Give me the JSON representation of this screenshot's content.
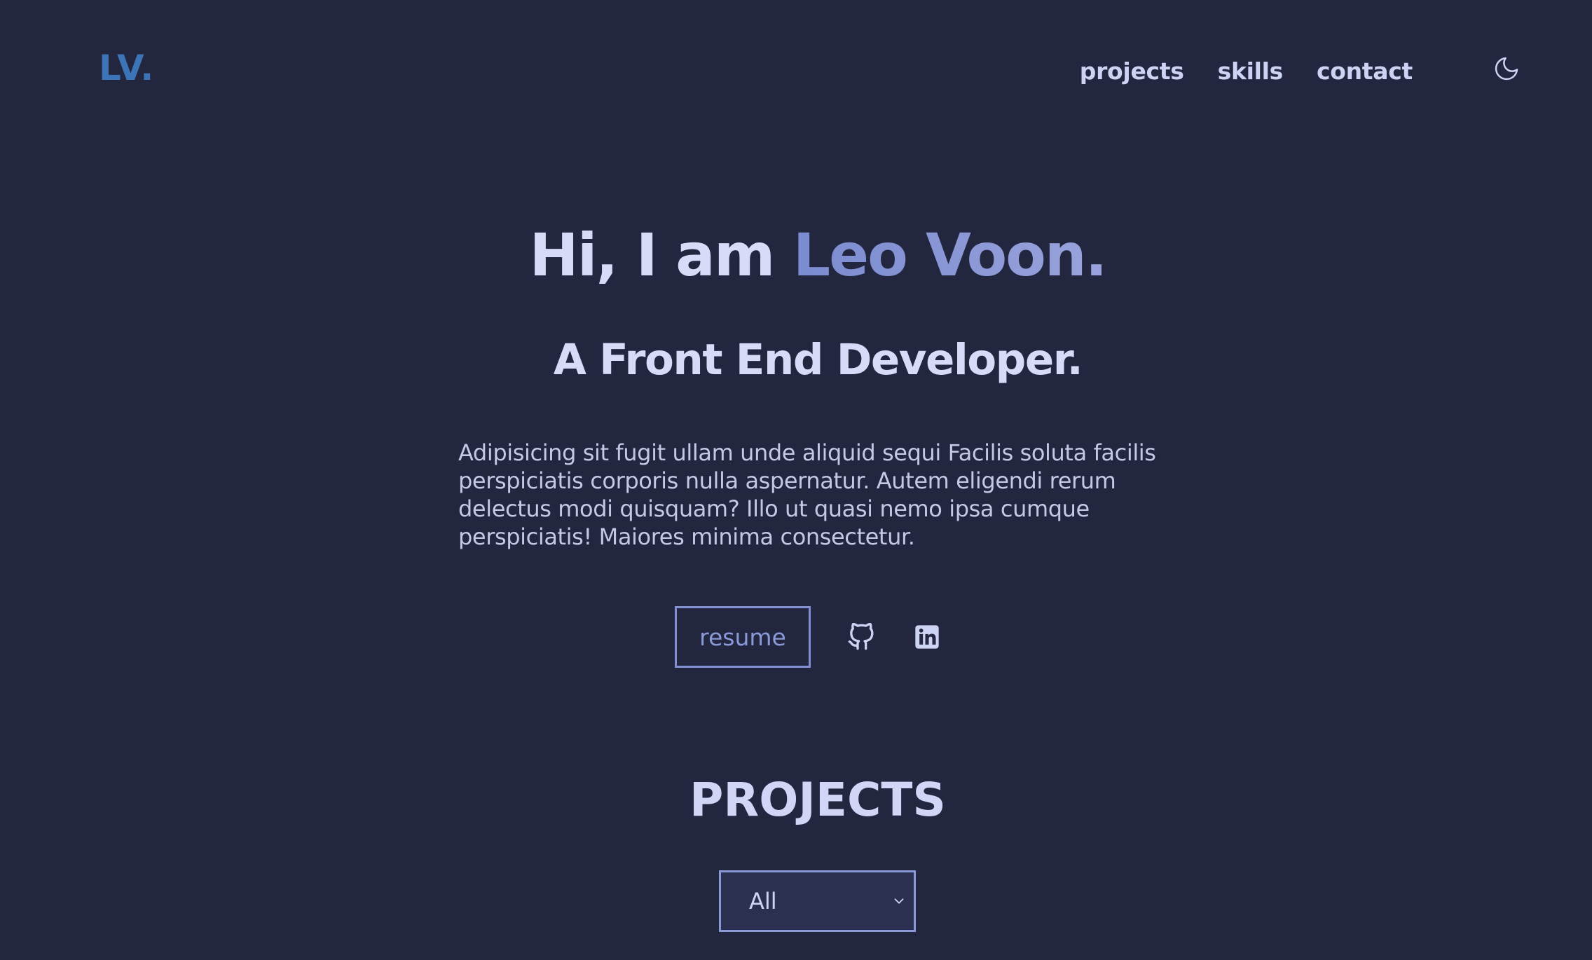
{
  "header": {
    "logo": "LV.",
    "nav": [
      {
        "label": "projects"
      },
      {
        "label": "skills"
      },
      {
        "label": "contact"
      }
    ],
    "theme_icon": "moon-icon"
  },
  "hero": {
    "greeting": "Hi, I am ",
    "name": "Leo Voon.",
    "subtitle": "A Front End Developer.",
    "description": "Adipisicing sit fugit ullam unde aliquid sequi Facilis soluta facilis perspiciatis corporis nulla aspernatur. Autem eligendi rerum delectus modi quisquam? Illo ut quasi nemo ipsa cumque perspiciatis! Maiores minima consectetur.",
    "resume_label": "resume",
    "social_icons": [
      "github-icon",
      "linkedin-icon"
    ]
  },
  "projects": {
    "title": "PROJECTS",
    "filter_selected": "All"
  },
  "colors": {
    "background": "#23263f",
    "logo": "#3d74b8",
    "accent": "#8090d3",
    "text": "#d8dbf7"
  }
}
